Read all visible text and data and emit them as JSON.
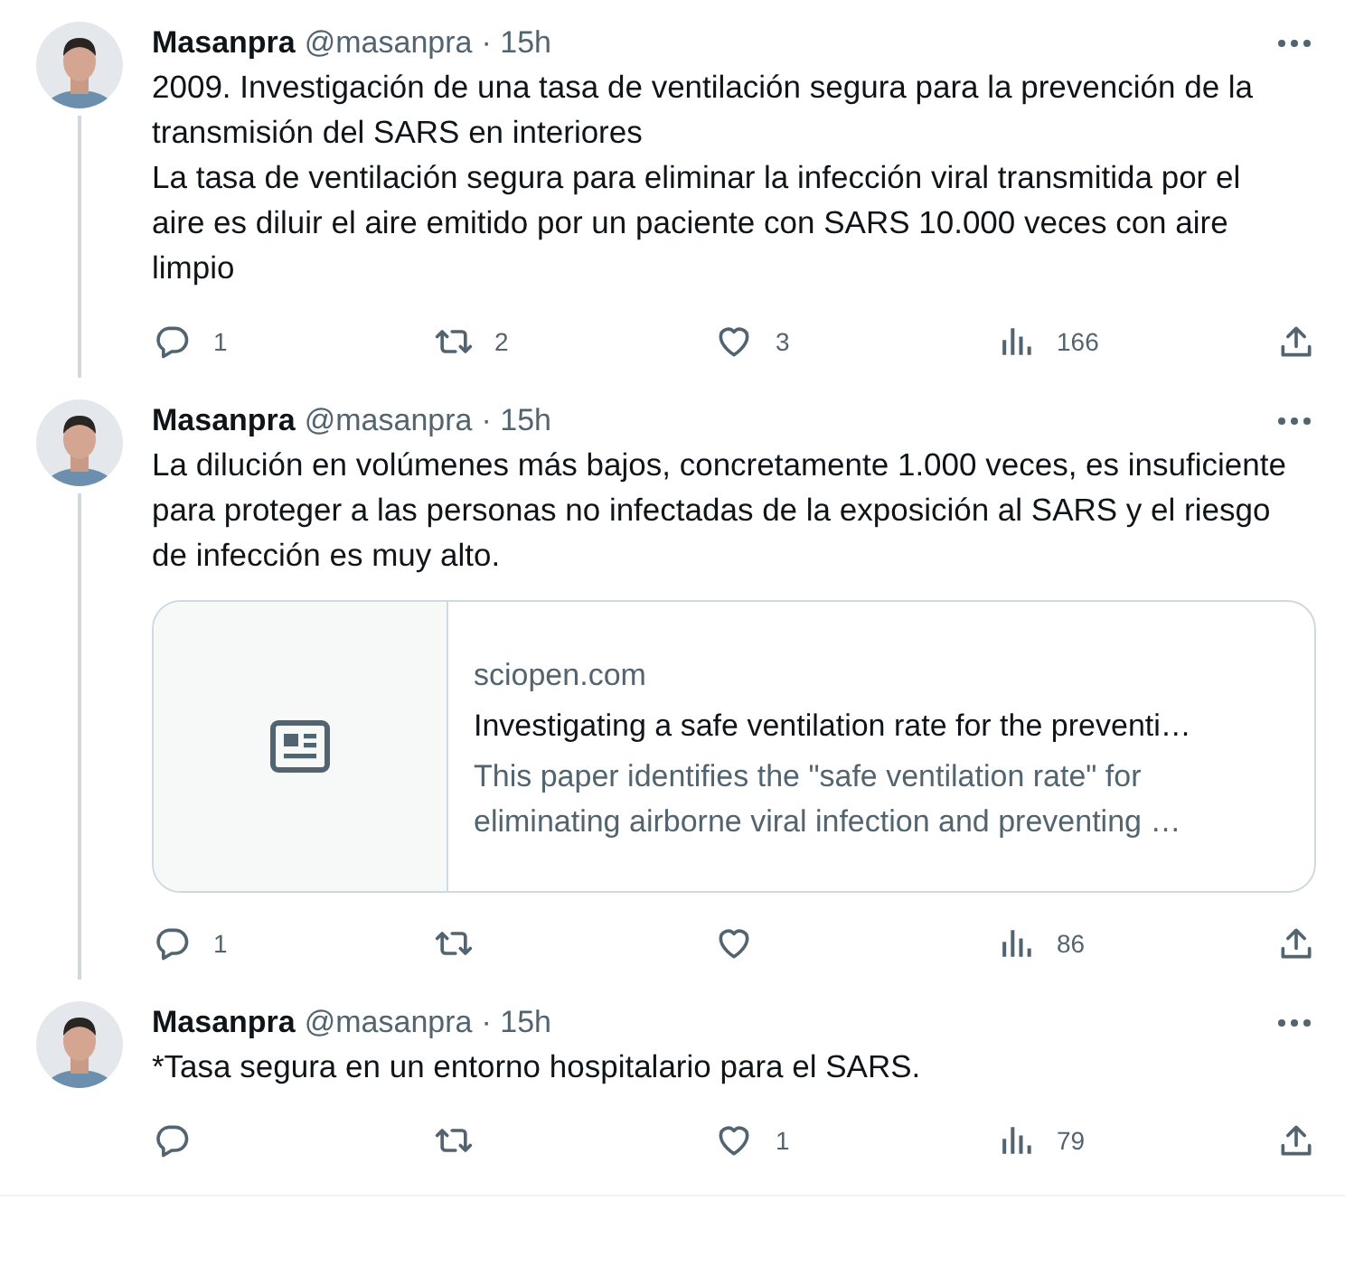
{
  "tweets": [
    {
      "author": "Masanpra",
      "handle": "@masanpra",
      "time": "· 15h",
      "connected": true,
      "body": [
        "2009. Investigación de una tasa de ventilación segura para la prevención de la transmisión del SARS en interiores",
        "La tasa de ventilación segura para eliminar la infección viral transmitida por el aire es diluir el aire emitido por un paciente con SARS 10.000 veces con aire limpio"
      ],
      "replies": "1",
      "reposts": "2",
      "likes": "3",
      "views": "166"
    },
    {
      "author": "Masanpra",
      "handle": "@masanpra",
      "time": "· 15h",
      "connected": true,
      "body": [
        "La dilución en volúmenes más bajos, concretamente 1.000 veces, es insuficiente para proteger a las personas no infectadas de la exposición al SARS y el riesgo de infección es muy alto."
      ],
      "card": {
        "domain": "sciopen.com",
        "title": "Investigating a safe ventilation rate for the preventi…",
        "description": "This paper identifies the \"safe ventilation rate\" for eliminating airborne viral infection and preventing …"
      },
      "replies": "1",
      "views": "86"
    },
    {
      "author": "Masanpra",
      "handle": "@masanpra",
      "time": "· 15h",
      "connected": false,
      "body": [
        "*Tasa segura en un entorno hospitalario para el SARS."
      ],
      "likes": "1",
      "views": "79"
    }
  ]
}
